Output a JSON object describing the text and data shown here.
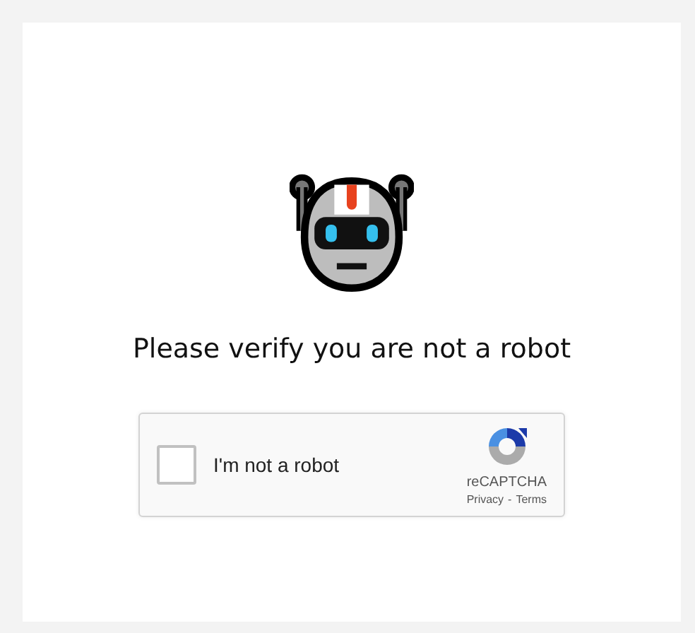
{
  "heading": "Please verify you are not a robot",
  "captcha": {
    "checked": false,
    "label": "I'm not a robot",
    "brand": "reCAPTCHA",
    "links": [
      "Privacy",
      "Terms"
    ],
    "separator": "-"
  }
}
